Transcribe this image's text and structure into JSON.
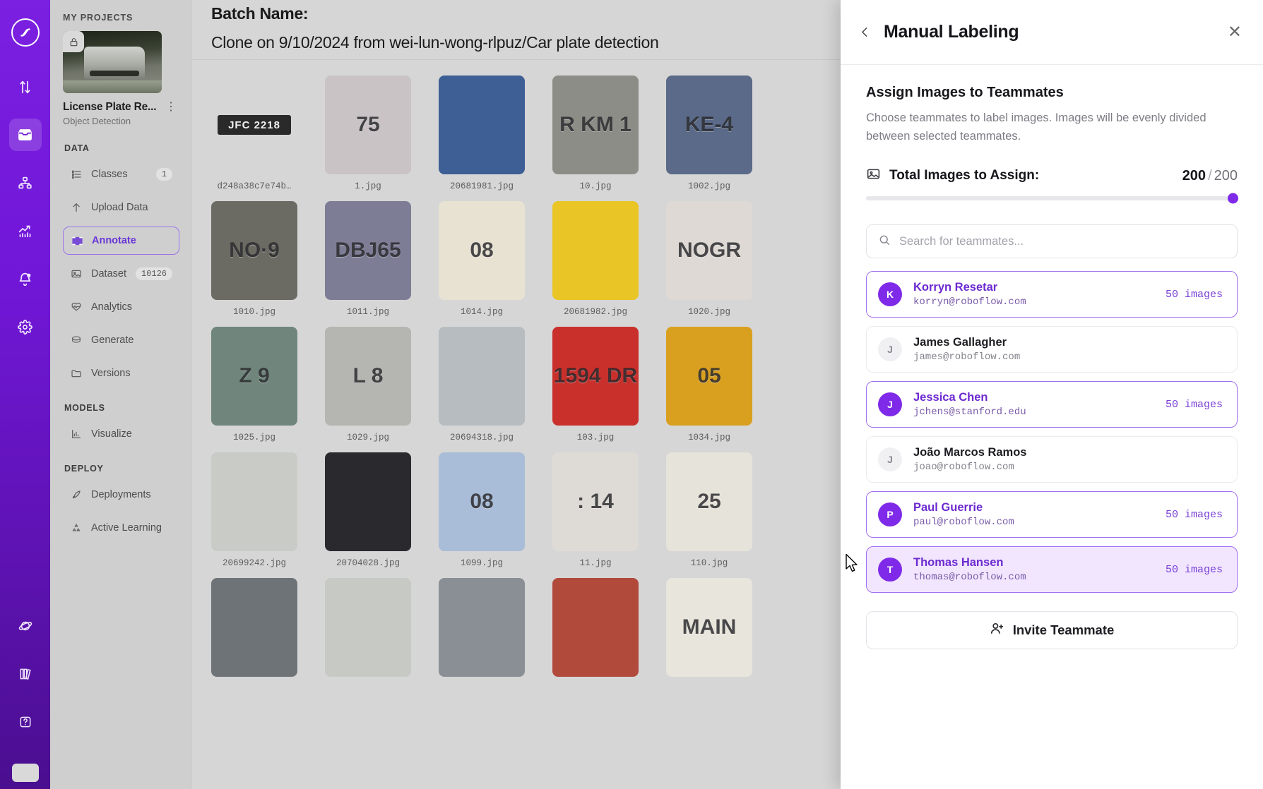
{
  "rail": {
    "logo": "roboflow-logo",
    "items": [
      {
        "name": "transfer-icon",
        "label": "Transfer"
      },
      {
        "name": "inbox-icon",
        "label": "Projects",
        "active": true
      },
      {
        "name": "workflows-icon",
        "label": "Workflows"
      },
      {
        "name": "analytics-icon",
        "label": "Analytics"
      },
      {
        "name": "notifications-icon",
        "label": "Notifications"
      },
      {
        "name": "settings-icon",
        "label": "Settings"
      }
    ],
    "bottom_items": [
      {
        "name": "universe-icon",
        "label": "Universe"
      },
      {
        "name": "docs-icon",
        "label": "Docs"
      },
      {
        "name": "help-icon",
        "label": "Help"
      }
    ]
  },
  "sidebar": {
    "my_projects_label": "MY PROJECTS",
    "project": {
      "title": "License Plate Re...",
      "type": "Object Detection",
      "lock_icon": "lock-icon",
      "menu_icon": "kebab-menu-icon"
    },
    "groups": [
      {
        "heading": "DATA",
        "items": [
          {
            "label": "Classes",
            "icon": "list-icon",
            "badge": "1",
            "active": false
          },
          {
            "label": "Upload Data",
            "icon": "upload-arrow-icon",
            "badge": "",
            "active": false
          },
          {
            "label": "Annotate",
            "icon": "annotate-icon",
            "badge": "",
            "active": true
          },
          {
            "label": "Dataset",
            "icon": "image-icon",
            "badge": "10126",
            "active": false
          },
          {
            "label": "Analytics",
            "icon": "heart-pulse-icon",
            "badge": "",
            "active": false
          },
          {
            "label": "Generate",
            "icon": "layers-icon",
            "badge": "",
            "active": false
          },
          {
            "label": "Versions",
            "icon": "folder-icon",
            "badge": "",
            "active": false
          }
        ]
      },
      {
        "heading": "MODELS",
        "items": [
          {
            "label": "Visualize",
            "icon": "bar-chart-icon",
            "badge": "",
            "active": false
          }
        ]
      },
      {
        "heading": "DEPLOY",
        "items": [
          {
            "label": "Deployments",
            "icon": "rocket-icon",
            "badge": "",
            "active": false
          },
          {
            "label": "Active Learning",
            "icon": "recycle-icon",
            "badge": "",
            "active": false
          }
        ]
      }
    ]
  },
  "main": {
    "batch_name_label": "Batch Name:",
    "batch_name_value": "Clone on 9/10/2024 from wei-lun-wong-rlpuz/Car plate detection",
    "images": [
      {
        "caption": "d248a38c7e74b…",
        "kind": "plate-dark",
        "text": "JFC 2218",
        "bg": "#d6d6d6"
      },
      {
        "caption": "1.jpg",
        "kind": "photo",
        "text": "75",
        "bg": "#c9c3c6"
      },
      {
        "caption": "20681981.jpg",
        "kind": "photo",
        "text": "",
        "bg": "#3d5f95"
      },
      {
        "caption": "10.jpg",
        "kind": "photo",
        "text": "R KM 1",
        "bg": "#8d8d87"
      },
      {
        "caption": "1002.jpg",
        "kind": "photo",
        "text": "KE-4",
        "bg": "#5a6a88"
      },
      {
        "caption": "1010.jpg",
        "kind": "photo",
        "text": "NO·9",
        "bg": "#6b6b63"
      },
      {
        "caption": "1011.jpg",
        "kind": "photo",
        "text": "DBJ65",
        "bg": "#7d7d96"
      },
      {
        "caption": "1014.jpg",
        "kind": "photo",
        "text": "08",
        "bg": "#e7e2d2"
      },
      {
        "caption": "20681982.jpg",
        "kind": "photo",
        "text": "",
        "bg": "#e9c525"
      },
      {
        "caption": "1020.jpg",
        "kind": "photo",
        "text": "NOGR",
        "bg": "#ded9d4"
      },
      {
        "caption": "1025.jpg",
        "kind": "photo",
        "text": "Z 9",
        "bg": "#70867c"
      },
      {
        "caption": "1029.jpg",
        "kind": "photo",
        "text": "L  8",
        "bg": "#b5b5b2"
      },
      {
        "caption": "20694318.jpg",
        "kind": "photo",
        "text": "",
        "bg": "#b7bcc0"
      },
      {
        "caption": "103.jpg",
        "kind": "photo",
        "text": "1594 DR",
        "bg": "#c9302c"
      },
      {
        "caption": "1034.jpg",
        "kind": "photo",
        "text": "05",
        "bg": "#d9a020"
      },
      {
        "caption": "20699242.jpg",
        "kind": "photo",
        "text": "",
        "bg": "#c9cbc6"
      },
      {
        "caption": "20704028.jpg",
        "kind": "photo",
        "text": "",
        "bg": "#2a2a2e"
      },
      {
        "caption": "1099.jpg",
        "kind": "photo",
        "text": "08",
        "bg": "#a9bcd8"
      },
      {
        "caption": "11.jpg",
        "kind": "photo",
        "text": ": 14",
        "bg": "#dedbd6"
      },
      {
        "caption": "110.jpg",
        "kind": "photo",
        "text": "25",
        "bg": "#e6e3da"
      },
      {
        "caption": "",
        "kind": "photo",
        "text": "",
        "bg": "#6e7378"
      },
      {
        "caption": "",
        "kind": "photo",
        "text": "",
        "bg": "#c7c9c4"
      },
      {
        "caption": "",
        "kind": "photo",
        "text": "",
        "bg": "#8a8f96"
      },
      {
        "caption": "",
        "kind": "photo",
        "text": "",
        "bg": "#b24a3c"
      },
      {
        "caption": "",
        "kind": "photo",
        "text": "MAIN",
        "bg": "#e8e5dc"
      }
    ]
  },
  "panel": {
    "title": "Manual Labeling",
    "back_icon": "chevron-left-icon",
    "close_icon": "close-icon",
    "section_title": "Assign Images to Teammates",
    "section_desc": "Choose teammates to label images. Images will be evenly divided between selected teammates.",
    "total_icon": "image-icon",
    "total_label": "Total Images to Assign:",
    "total_current": "200",
    "total_separator": "/",
    "total_max": "200",
    "search": {
      "icon": "search-icon",
      "placeholder": "Search for teammates...",
      "value": ""
    },
    "teammates": [
      {
        "initial": "K",
        "name": "Korryn Resetar",
        "email": "korryn@roboflow.com",
        "count": "50 images",
        "selected": true,
        "hovered": false
      },
      {
        "initial": "J",
        "name": "James Gallagher",
        "email": "james@roboflow.com",
        "count": "",
        "selected": false,
        "hovered": false
      },
      {
        "initial": "J",
        "name": "Jessica Chen",
        "email": "jchens@stanford.edu",
        "count": "50 images",
        "selected": true,
        "hovered": false
      },
      {
        "initial": "J",
        "name": "João Marcos Ramos",
        "email": "joao@roboflow.com",
        "count": "",
        "selected": false,
        "hovered": false
      },
      {
        "initial": "P",
        "name": "Paul Guerrie",
        "email": "paul@roboflow.com",
        "count": "50 images",
        "selected": true,
        "hovered": false
      },
      {
        "initial": "T",
        "name": "Thomas Hansen",
        "email": "thomas@roboflow.com",
        "count": "50 images",
        "selected": true,
        "hovered": true
      }
    ],
    "invite_icon": "user-plus-icon",
    "invite_label": "Invite Teammate"
  },
  "colors": {
    "brand_purple": "#7f2ae8",
    "rail_purple": "#6d17d1",
    "selected_border": "#a171ef",
    "selected_bg": "#f1e6fe",
    "accent_text": "#6c2ad0"
  }
}
